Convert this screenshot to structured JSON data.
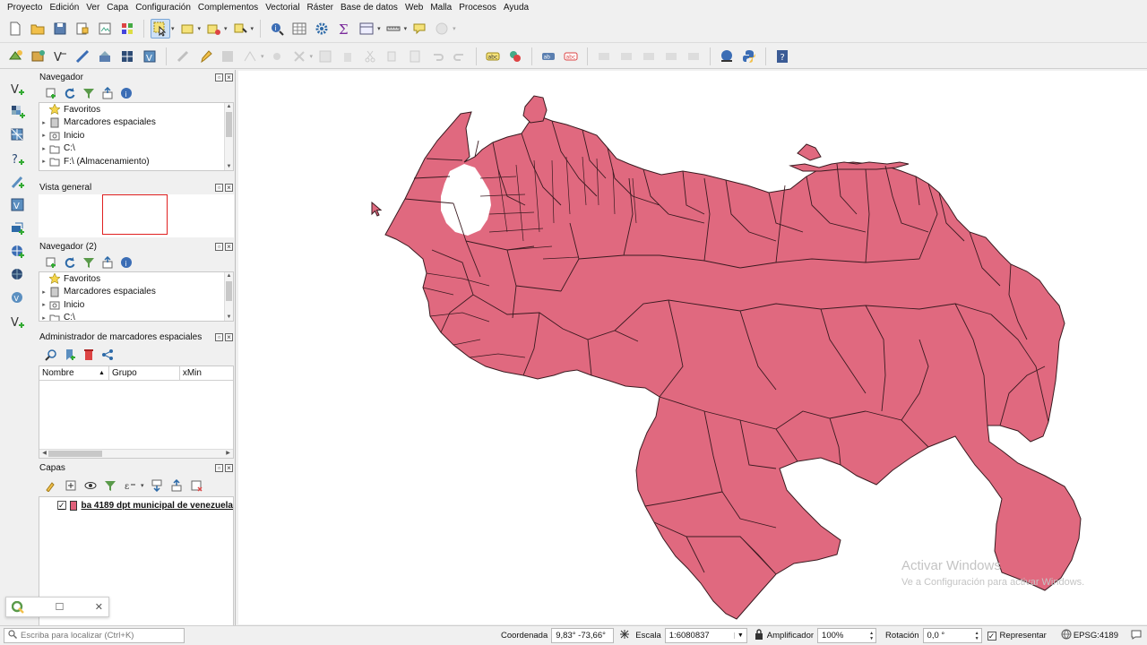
{
  "menu": [
    "Proyecto",
    "Edición",
    "Ver",
    "Capa",
    "Configuración",
    "Complementos",
    "Vectorial",
    "Ráster",
    "Base de datos",
    "Web",
    "Malla",
    "Procesos",
    "Ayuda"
  ],
  "panels": {
    "browser": {
      "title": "Navegador",
      "items": [
        "Favoritos",
        "Marcadores espaciales",
        "Inicio",
        "C:\\",
        "F:\\ (Almacenamiento)"
      ]
    },
    "overview": {
      "title": "Vista general"
    },
    "browser2": {
      "title": "Navegador (2)",
      "items": [
        "Favoritos",
        "Marcadores espaciales",
        "Inicio",
        "C:\\"
      ]
    },
    "bookmarks": {
      "title": "Administrador de marcadores espaciales",
      "columns": [
        "Nombre",
        "Grupo",
        "xMin"
      ]
    },
    "layers": {
      "title": "Capas",
      "layer_name": "ba 4189 dpt municipal de venezuela",
      "layer_color": "#e0607a"
    }
  },
  "map": {
    "fill_color": "#e0697f",
    "stroke_color": "#3a1a20",
    "watermark_line1": "Activar Windows",
    "watermark_line2": "Ve a Configuración para activar Windows."
  },
  "status": {
    "locator_placeholder": "Escriba para localizar (Ctrl+K)",
    "coord_label": "Coordenada",
    "coord_value": "9,83° -73,66°",
    "scale_label": "Escala",
    "scale_value": "1:6080837",
    "magnifier_label": "Amplificador",
    "magnifier_value": "100%",
    "rotation_label": "Rotación",
    "rotation_value": "0,0 °",
    "render_label": "Representar",
    "crs": "EPSG:4189"
  }
}
